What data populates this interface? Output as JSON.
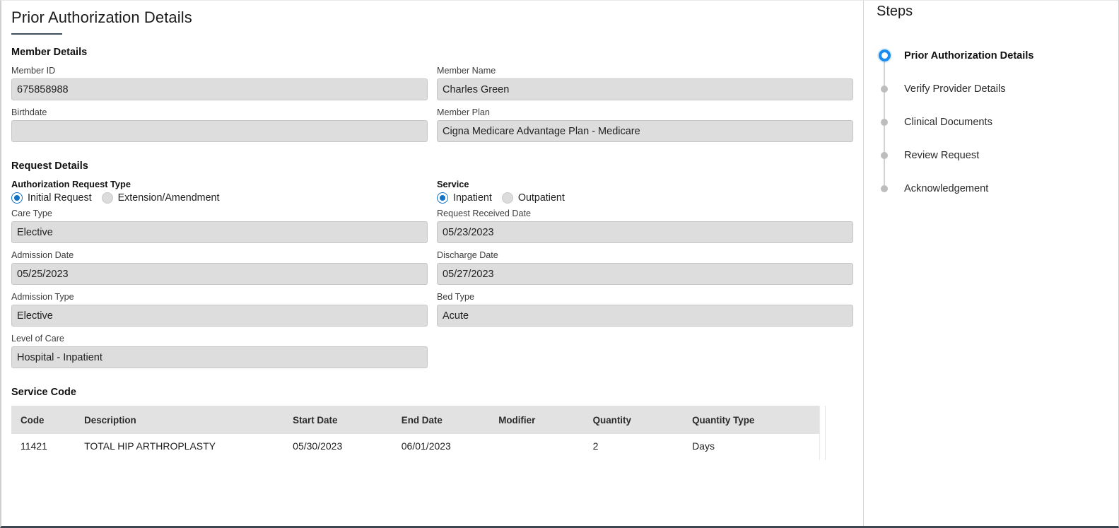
{
  "page": {
    "title": "Prior Authorization Details",
    "accent_rule_color": "#3e4e5e"
  },
  "member_details": {
    "heading": "Member Details",
    "fields": [
      {
        "label": "Member ID",
        "value": "675858988"
      },
      {
        "label": "Member Name",
        "value": "Charles Green"
      },
      {
        "label": "Birthdate",
        "value": ""
      },
      {
        "label": "Member Plan",
        "value": "Cigna Medicare Advantage Plan - Medicare"
      }
    ]
  },
  "request_details": {
    "heading": "Request Details",
    "auth_request_type": {
      "label": "Authorization Request Type",
      "options": [
        {
          "label": "Initial Request",
          "selected": true
        },
        {
          "label": "Extension/Amendment",
          "selected": false
        }
      ]
    },
    "service": {
      "label": "Service",
      "options": [
        {
          "label": "Inpatient",
          "selected": true
        },
        {
          "label": "Outpatient",
          "selected": false
        }
      ]
    },
    "fields": [
      {
        "label": "Care Type",
        "value": "Elective"
      },
      {
        "label": "Request Received Date",
        "value": "05/23/2023"
      },
      {
        "label": "Admission Date",
        "value": "05/25/2023"
      },
      {
        "label": "Discharge Date",
        "value": "05/27/2023"
      },
      {
        "label": "Admission Type",
        "value": "Elective"
      },
      {
        "label": "Bed Type",
        "value": "Acute"
      },
      {
        "label": "Level of Care",
        "value": "Hospital - Inpatient"
      }
    ]
  },
  "service_code": {
    "heading": "Service Code",
    "columns": [
      "Code",
      "Description",
      "Start Date",
      "End Date",
      "Modifier",
      "Quantity",
      "Quantity Type"
    ],
    "rows": [
      {
        "code": "11421",
        "description": "TOTAL HIP ARTHROPLASTY",
        "start_date": "05/30/2023",
        "end_date": "06/01/2023",
        "modifier": "",
        "quantity": "2",
        "quantity_type": "Days"
      }
    ]
  },
  "steps": {
    "title": "Steps",
    "active_color": "#1a8cf0",
    "items": [
      {
        "label": "Prior Authorization Details",
        "active": true
      },
      {
        "label": "Verify Provider Details",
        "active": false
      },
      {
        "label": "Clinical Documents",
        "active": false
      },
      {
        "label": "Review Request",
        "active": false
      },
      {
        "label": "Acknowledgement",
        "active": false
      }
    ]
  }
}
